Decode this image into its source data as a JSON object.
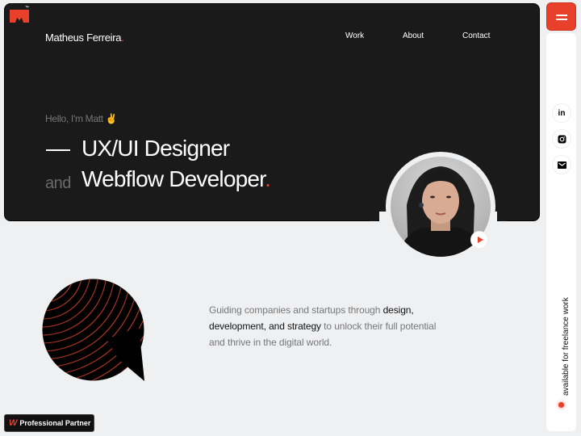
{
  "header": {
    "brand_name": "Matheus Ferreira",
    "brand_dot": ".",
    "logo_tm": "™",
    "nav": [
      {
        "label": "Work"
      },
      {
        "label": "About"
      },
      {
        "label": "Contact"
      }
    ]
  },
  "hero": {
    "greeting": "Hello, I'm Matt ✌️",
    "title_line1": "UX/UI Designer",
    "connector": "and",
    "title_line2": "Webflow Developer",
    "title_dot": "."
  },
  "intro": {
    "text_before": "Guiding companies and startups through ",
    "text_highlight": "design, development, and strategy",
    "text_after": " to unlock their full potential and thrive in the digital world."
  },
  "sidebar": {
    "menu_icon": "hamburger-icon",
    "socials": [
      {
        "name": "linkedin",
        "glyph": "in"
      },
      {
        "name": "instagram",
        "glyph": "◙"
      },
      {
        "name": "email",
        "glyph": "✉"
      }
    ],
    "availability": "available for freelance work"
  },
  "badge": {
    "mark": "W",
    "label": "Professional Partner"
  },
  "colors": {
    "accent": "#e8402a",
    "hero_bg": "#1a1a1a",
    "page_bg": "#eff0f2"
  }
}
